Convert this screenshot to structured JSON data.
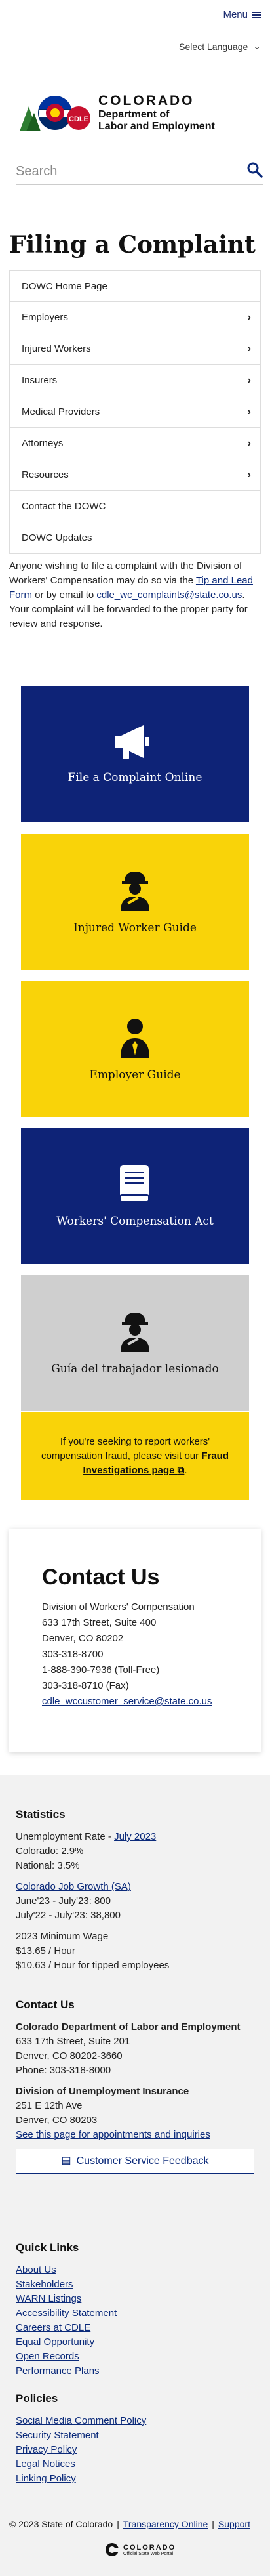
{
  "header": {
    "menu_label": "Menu",
    "language_label": "Select Language"
  },
  "logo": {
    "state_text": "COLORADO",
    "dept_line1": "Department of",
    "dept_line2": "Labor and Employment",
    "badge_text": "CDLE"
  },
  "search": {
    "placeholder": "Search"
  },
  "page": {
    "title": "Filing a Complaint"
  },
  "nav": {
    "items": [
      {
        "label": "DOWC Home Page",
        "has_chevron": false
      },
      {
        "label": "Employers",
        "has_chevron": true
      },
      {
        "label": "Injured Workers",
        "has_chevron": true
      },
      {
        "label": "Insurers",
        "has_chevron": true
      },
      {
        "label": "Medical Providers",
        "has_chevron": true
      },
      {
        "label": "Attorneys",
        "has_chevron": true
      },
      {
        "label": "Resources",
        "has_chevron": true
      },
      {
        "label": "Contact the DOWC",
        "has_chevron": false
      },
      {
        "label": "DOWC Updates",
        "has_chevron": false
      }
    ]
  },
  "intro": {
    "text_before": "Anyone wishing to file a complaint with the Division of Workers' Compensation may do so via the ",
    "link1": "Tip and Lead Form",
    "text_mid": " or by email to ",
    "email_link": "cdle_wc_complaints@state.co.us",
    "text_after": ". Your complaint will be forwarded to the proper party for review and response."
  },
  "tiles": [
    {
      "label": "File a Complaint Online",
      "icon": "megaphone-icon",
      "color": "#0e2377"
    },
    {
      "label": "Injured Worker Guide",
      "icon": "injured-worker-icon",
      "color": "#f9d309"
    },
    {
      "label": "Employer Guide",
      "icon": "employer-icon",
      "color": "#f9d309"
    },
    {
      "label": "Workers' Compensation Act",
      "icon": "book-icon",
      "color": "#0e2377"
    },
    {
      "label": "Guía del trabajador lesionado",
      "icon": "injured-worker-icon",
      "color": "#cfcfcf"
    }
  ],
  "fraud": {
    "text": "If you're seeking to report workers' compensation fraud, please visit our ",
    "link": "Fraud Investigations page",
    "end": "."
  },
  "contact": {
    "heading": "Contact Us",
    "lines": [
      "Division of Workers' Compensation",
      "633 17th Street, Suite 400",
      "Denver, CO 80202",
      "303-318-8700",
      "1-888-390-7936 (Toll-Free)",
      "303-318-8710 (Fax)"
    ],
    "email": "cdle_wccustomer_service@state.co.us"
  },
  "footer": {
    "statistics": {
      "heading": "Statistics",
      "unemployment_label": "Unemployment Rate - ",
      "unemployment_link": "July 2023",
      "colorado": "Colorado: 2.9%",
      "national": "National: 3.5%",
      "job_growth_link": "Colorado Job Growth (SA)",
      "jg1": "June'23 - July'23: 800",
      "jg2": "July'22 - July'23: 38,800",
      "min_wage_title": "2023 Minimum Wage",
      "mw1": "$13.65 / Hour",
      "mw2": "$10.63 / Hour for tipped employees"
    },
    "contact": {
      "heading": "Contact Us",
      "org1": "Colorado Department of Labor and Employment",
      "org1_lines": [
        "633 17th Street, Suite 201",
        "Denver, CO  80202-3660",
        "Phone: 303-318-8000"
      ],
      "org2": "Division of Unemployment Insurance",
      "org2_lines": [
        "251 E 12th Ave",
        "Denver, CO  80203"
      ],
      "appt_link": "See this page for appointments and inquiries",
      "feedback_button": "Customer Service Feedback"
    },
    "quick_links": {
      "heading": "Quick Links",
      "items": [
        "About Us",
        "Stakeholders",
        "WARN Listings",
        "Accessibility Statement",
        "Careers at CDLE",
        "Equal Opportunity",
        "Open Records",
        "Performance Plans"
      ]
    },
    "policies": {
      "heading": "Policies",
      "items": [
        "Social Media Comment Policy",
        "Security Statement",
        "Privacy Policy",
        "Legal Notices",
        "Linking Policy"
      ]
    },
    "bottom": {
      "copyright": "© 2023 State of Colorado",
      "transparency": "Transparency Online",
      "support": "Support",
      "state_logo_text": "COLORADO",
      "state_logo_sub": "Official State Web Portal"
    }
  },
  "colors": {
    "navy": "#0e2377",
    "yellow": "#f9d309",
    "link": "#0b2a7a"
  }
}
